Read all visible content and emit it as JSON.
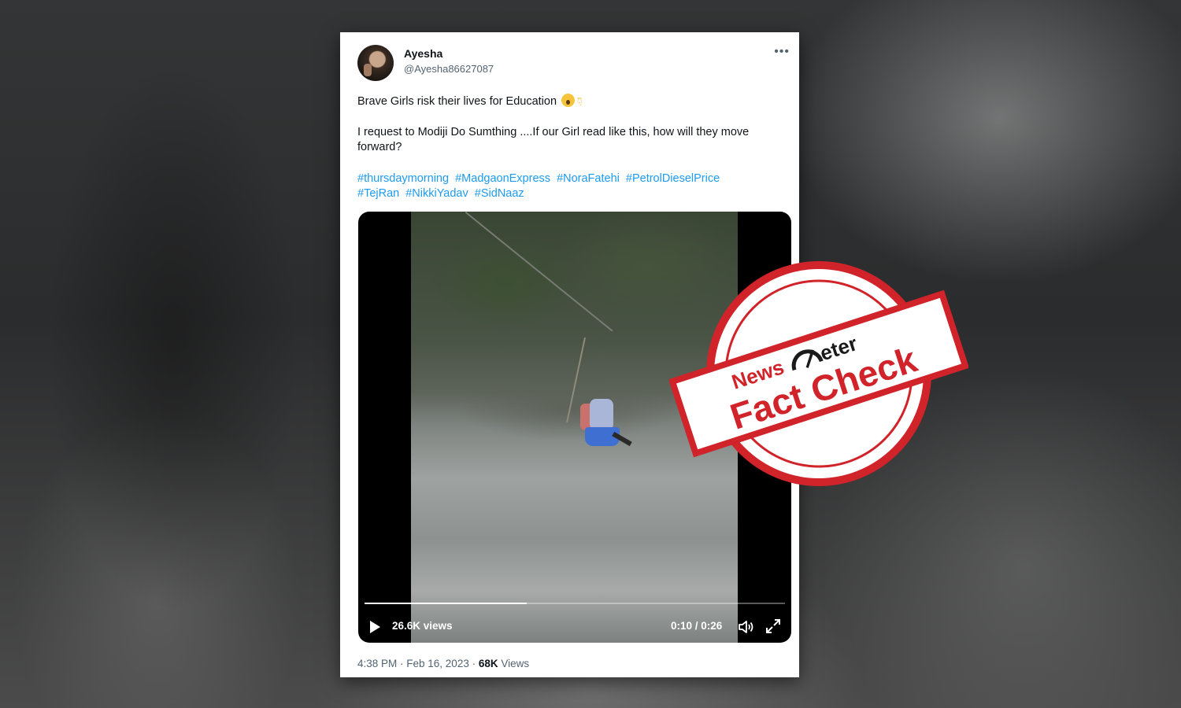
{
  "tweet": {
    "display_name": "Ayesha",
    "handle": "@Ayesha86627087",
    "more_label": "•••",
    "text_line1": "Brave Girls risk their lives for Education",
    "text_line2": "I request to Modiji Do Sumthing ....If our Girl read like this, how will they move forward?",
    "hashtags": [
      "#thursdaymorning",
      "#MadgaonExpress",
      "#NoraFatehi",
      "#PetrolDieselPrice",
      "#TejRan",
      "#NikkiYadav",
      "#SidNaaz"
    ],
    "timestamp": "4:38 PM · Feb 16, 2023 · ",
    "views_count": "68K",
    "views_suffix": " Views"
  },
  "video": {
    "views": "26.6K views",
    "time": "0:10 / 0:26",
    "progress": 0.385
  },
  "stamp": {
    "brand_left": "News",
    "brand_right": "eter",
    "label": "Fact Check",
    "color": "#d1232a"
  },
  "icons": [
    "avatar",
    "play-icon",
    "volume-icon",
    "fullscreen-icon",
    "more-icon",
    "emoji-astonished",
    "emoji-pointing-down"
  ]
}
